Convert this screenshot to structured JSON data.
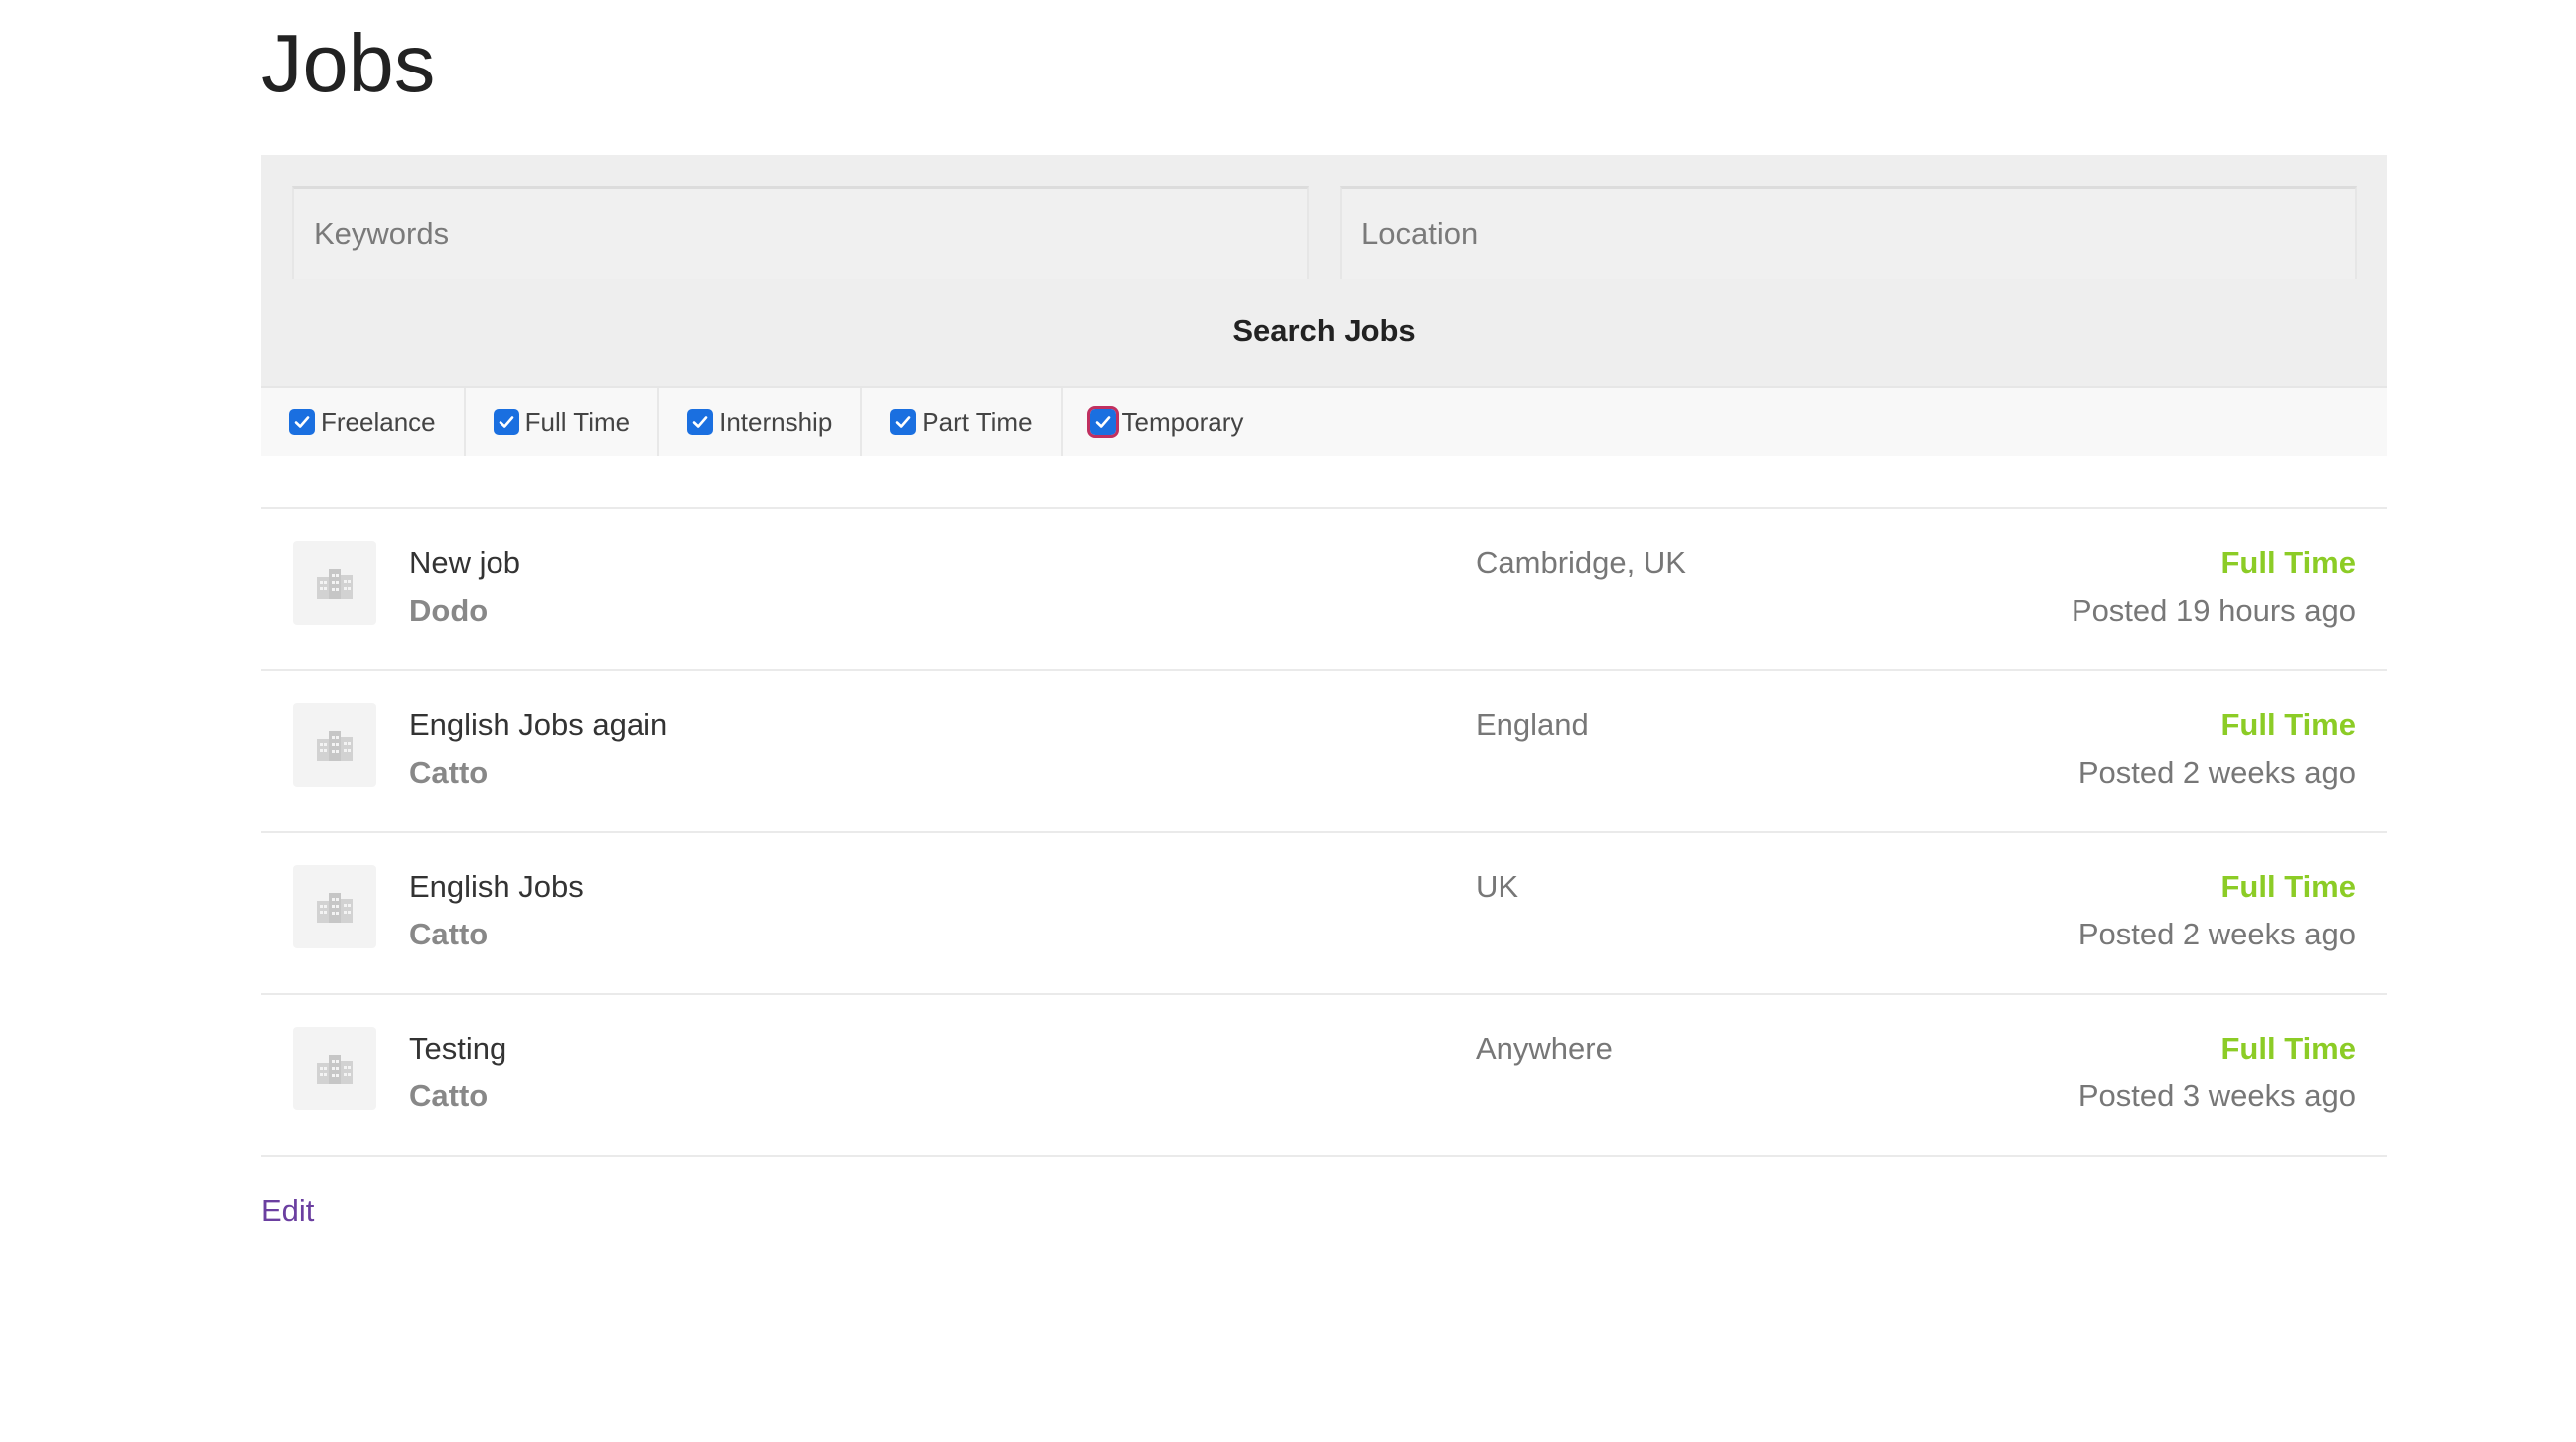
{
  "page": {
    "title": "Jobs"
  },
  "search": {
    "keywords_placeholder": "Keywords",
    "location_placeholder": "Location",
    "button_label": "Search Jobs"
  },
  "filters": [
    {
      "label": "Freelance",
      "checked": true
    },
    {
      "label": "Full Time",
      "checked": true
    },
    {
      "label": "Internship",
      "checked": true
    },
    {
      "label": "Part Time",
      "checked": true
    },
    {
      "label": "Temporary",
      "checked": true
    }
  ],
  "jobs": [
    {
      "title": "New job",
      "company": "Dodo",
      "location": "Cambridge, UK",
      "type": "Full Time",
      "posted": "Posted 19 hours ago"
    },
    {
      "title": "English Jobs again",
      "company": "Catto",
      "location": "England",
      "type": "Full Time",
      "posted": "Posted 2 weeks ago"
    },
    {
      "title": "English Jobs",
      "company": "Catto",
      "location": "UK",
      "type": "Full Time",
      "posted": "Posted 2 weeks ago"
    },
    {
      "title": "Testing",
      "company": "Catto",
      "location": "Anywhere",
      "type": "Full Time",
      "posted": "Posted 3 weeks ago"
    }
  ],
  "footer": {
    "edit_label": "Edit"
  },
  "colors": {
    "job_type": "#8ccc26",
    "checkbox": "#1a6fe0",
    "edit_link": "#6b3fa0"
  },
  "icons": {
    "checkbox": "checkmark-icon",
    "company_logo": "building-icon"
  }
}
